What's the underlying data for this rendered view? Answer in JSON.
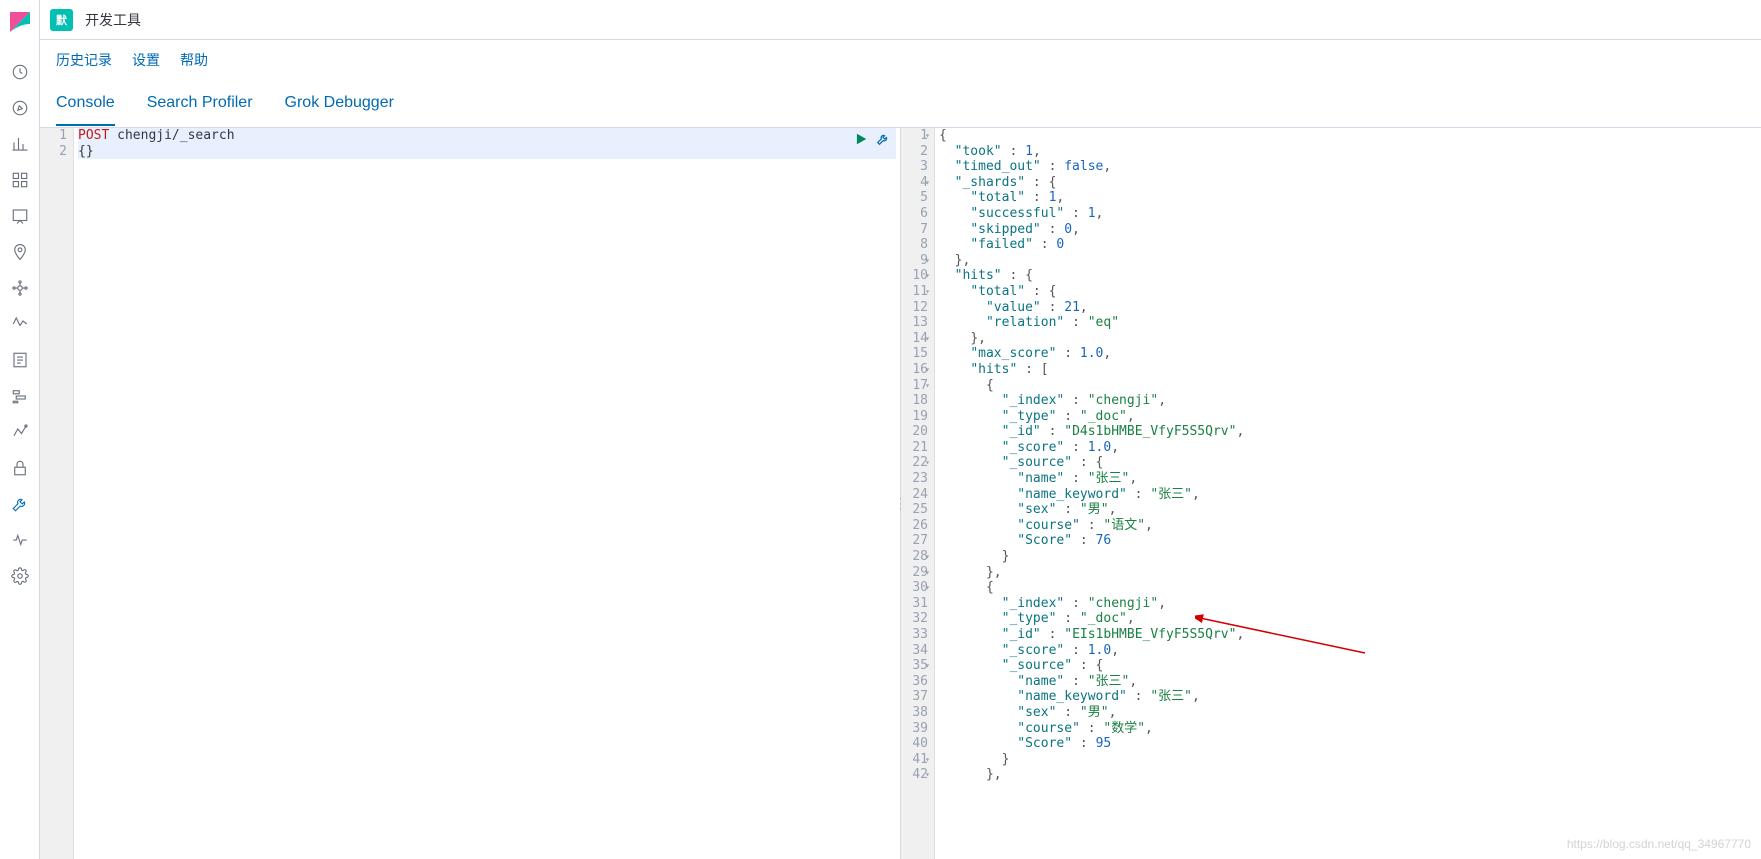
{
  "topbar": {
    "badge": "默",
    "title": "开发工具"
  },
  "subbar": {
    "history": "历史记录",
    "settings": "设置",
    "help": "帮助"
  },
  "tabs": {
    "console": "Console",
    "profiler": "Search Profiler",
    "grok": "Grok Debugger"
  },
  "request": {
    "lines": [
      {
        "num": "1",
        "method": "POST",
        "path": "chengji/_search"
      },
      {
        "num": "2",
        "body": "{}"
      }
    ]
  },
  "response": {
    "lines": [
      {
        "n": "1",
        "fold": true,
        "raw": [
          {
            "p": "{"
          }
        ]
      },
      {
        "n": "2",
        "raw": [
          {
            "t": "ind",
            "v": "  "
          },
          {
            "t": "key",
            "v": "\"took\""
          },
          {
            "p": " : "
          },
          {
            "t": "num",
            "v": "1"
          },
          {
            "p": ","
          }
        ]
      },
      {
        "n": "3",
        "raw": [
          {
            "t": "ind",
            "v": "  "
          },
          {
            "t": "key",
            "v": "\"timed_out\""
          },
          {
            "p": " : "
          },
          {
            "t": "bool",
            "v": "false"
          },
          {
            "p": ","
          }
        ]
      },
      {
        "n": "4",
        "fold": true,
        "raw": [
          {
            "t": "ind",
            "v": "  "
          },
          {
            "t": "key",
            "v": "\"_shards\""
          },
          {
            "p": " : {"
          }
        ]
      },
      {
        "n": "5",
        "raw": [
          {
            "t": "ind",
            "v": "    "
          },
          {
            "t": "key",
            "v": "\"total\""
          },
          {
            "p": " : "
          },
          {
            "t": "num",
            "v": "1"
          },
          {
            "p": ","
          }
        ]
      },
      {
        "n": "6",
        "raw": [
          {
            "t": "ind",
            "v": "    "
          },
          {
            "t": "key",
            "v": "\"successful\""
          },
          {
            "p": " : "
          },
          {
            "t": "num",
            "v": "1"
          },
          {
            "p": ","
          }
        ]
      },
      {
        "n": "7",
        "raw": [
          {
            "t": "ind",
            "v": "    "
          },
          {
            "t": "key",
            "v": "\"skipped\""
          },
          {
            "p": " : "
          },
          {
            "t": "num",
            "v": "0"
          },
          {
            "p": ","
          }
        ]
      },
      {
        "n": "8",
        "raw": [
          {
            "t": "ind",
            "v": "    "
          },
          {
            "t": "key",
            "v": "\"failed\""
          },
          {
            "p": " : "
          },
          {
            "t": "num",
            "v": "0"
          }
        ]
      },
      {
        "n": "9",
        "fold": true,
        "raw": [
          {
            "t": "ind",
            "v": "  "
          },
          {
            "p": "},"
          }
        ]
      },
      {
        "n": "10",
        "fold": true,
        "raw": [
          {
            "t": "ind",
            "v": "  "
          },
          {
            "t": "key",
            "v": "\"hits\""
          },
          {
            "p": " : {"
          }
        ]
      },
      {
        "n": "11",
        "fold": true,
        "raw": [
          {
            "t": "ind",
            "v": "    "
          },
          {
            "t": "key",
            "v": "\"total\""
          },
          {
            "p": " : {"
          }
        ]
      },
      {
        "n": "12",
        "raw": [
          {
            "t": "ind",
            "v": "      "
          },
          {
            "t": "key",
            "v": "\"value\""
          },
          {
            "p": " : "
          },
          {
            "t": "num",
            "v": "21"
          },
          {
            "p": ","
          }
        ]
      },
      {
        "n": "13",
        "raw": [
          {
            "t": "ind",
            "v": "      "
          },
          {
            "t": "key",
            "v": "\"relation\""
          },
          {
            "p": " : "
          },
          {
            "t": "str",
            "v": "\"eq\""
          }
        ]
      },
      {
        "n": "14",
        "fold": true,
        "raw": [
          {
            "t": "ind",
            "v": "    "
          },
          {
            "p": "},"
          }
        ]
      },
      {
        "n": "15",
        "raw": [
          {
            "t": "ind",
            "v": "    "
          },
          {
            "t": "key",
            "v": "\"max_score\""
          },
          {
            "p": " : "
          },
          {
            "t": "num",
            "v": "1.0"
          },
          {
            "p": ","
          }
        ]
      },
      {
        "n": "16",
        "fold": true,
        "raw": [
          {
            "t": "ind",
            "v": "    "
          },
          {
            "t": "key",
            "v": "\"hits\""
          },
          {
            "p": " : ["
          }
        ]
      },
      {
        "n": "17",
        "fold": true,
        "raw": [
          {
            "t": "ind",
            "v": "      "
          },
          {
            "p": "{"
          }
        ]
      },
      {
        "n": "18",
        "raw": [
          {
            "t": "ind",
            "v": "        "
          },
          {
            "t": "key",
            "v": "\"_index\""
          },
          {
            "p": " : "
          },
          {
            "t": "str",
            "v": "\"chengji\""
          },
          {
            "p": ","
          }
        ]
      },
      {
        "n": "19",
        "raw": [
          {
            "t": "ind",
            "v": "        "
          },
          {
            "t": "key",
            "v": "\"_type\""
          },
          {
            "p": " : "
          },
          {
            "t": "str",
            "v": "\"_doc\""
          },
          {
            "p": ","
          }
        ]
      },
      {
        "n": "20",
        "raw": [
          {
            "t": "ind",
            "v": "        "
          },
          {
            "t": "key",
            "v": "\"_id\""
          },
          {
            "p": " : "
          },
          {
            "t": "str",
            "v": "\"D4s1bHMBE_VfyF5S5Qrv\""
          },
          {
            "p": ","
          }
        ]
      },
      {
        "n": "21",
        "raw": [
          {
            "t": "ind",
            "v": "        "
          },
          {
            "t": "key",
            "v": "\"_score\""
          },
          {
            "p": " : "
          },
          {
            "t": "num",
            "v": "1.0"
          },
          {
            "p": ","
          }
        ]
      },
      {
        "n": "22",
        "fold": true,
        "raw": [
          {
            "t": "ind",
            "v": "        "
          },
          {
            "t": "key",
            "v": "\"_source\""
          },
          {
            "p": " : {"
          }
        ]
      },
      {
        "n": "23",
        "raw": [
          {
            "t": "ind",
            "v": "          "
          },
          {
            "t": "key",
            "v": "\"name\""
          },
          {
            "p": " : "
          },
          {
            "t": "str",
            "v": "\"张三\""
          },
          {
            "p": ","
          }
        ]
      },
      {
        "n": "24",
        "raw": [
          {
            "t": "ind",
            "v": "          "
          },
          {
            "t": "key",
            "v": "\"name_keyword\""
          },
          {
            "p": " : "
          },
          {
            "t": "str",
            "v": "\"张三\""
          },
          {
            "p": ","
          }
        ]
      },
      {
        "n": "25",
        "raw": [
          {
            "t": "ind",
            "v": "          "
          },
          {
            "t": "key",
            "v": "\"sex\""
          },
          {
            "p": " : "
          },
          {
            "t": "str",
            "v": "\"男\""
          },
          {
            "p": ","
          }
        ]
      },
      {
        "n": "26",
        "raw": [
          {
            "t": "ind",
            "v": "          "
          },
          {
            "t": "key",
            "v": "\"course\""
          },
          {
            "p": " : "
          },
          {
            "t": "str",
            "v": "\"语文\""
          },
          {
            "p": ","
          }
        ]
      },
      {
        "n": "27",
        "raw": [
          {
            "t": "ind",
            "v": "          "
          },
          {
            "t": "key",
            "v": "\"Score\""
          },
          {
            "p": " : "
          },
          {
            "t": "num",
            "v": "76"
          }
        ]
      },
      {
        "n": "28",
        "fold": true,
        "raw": [
          {
            "t": "ind",
            "v": "        "
          },
          {
            "p": "}"
          }
        ]
      },
      {
        "n": "29",
        "fold": true,
        "raw": [
          {
            "t": "ind",
            "v": "      "
          },
          {
            "p": "},"
          }
        ]
      },
      {
        "n": "30",
        "fold": true,
        "raw": [
          {
            "t": "ind",
            "v": "      "
          },
          {
            "p": "{"
          }
        ]
      },
      {
        "n": "31",
        "raw": [
          {
            "t": "ind",
            "v": "        "
          },
          {
            "t": "key",
            "v": "\"_index\""
          },
          {
            "p": " : "
          },
          {
            "t": "str",
            "v": "\"chengji\""
          },
          {
            "p": ","
          }
        ]
      },
      {
        "n": "32",
        "raw": [
          {
            "t": "ind",
            "v": "        "
          },
          {
            "t": "key",
            "v": "\"_type\""
          },
          {
            "p": " : "
          },
          {
            "t": "str",
            "v": "\"_doc\""
          },
          {
            "p": ","
          }
        ]
      },
      {
        "n": "33",
        "raw": [
          {
            "t": "ind",
            "v": "        "
          },
          {
            "t": "key",
            "v": "\"_id\""
          },
          {
            "p": " : "
          },
          {
            "t": "str",
            "v": "\"EIs1bHMBE_VfyF5S5Qrv\""
          },
          {
            "p": ","
          }
        ]
      },
      {
        "n": "34",
        "raw": [
          {
            "t": "ind",
            "v": "        "
          },
          {
            "t": "key",
            "v": "\"_score\""
          },
          {
            "p": " : "
          },
          {
            "t": "num",
            "v": "1.0"
          },
          {
            "p": ","
          }
        ]
      },
      {
        "n": "35",
        "fold": true,
        "raw": [
          {
            "t": "ind",
            "v": "        "
          },
          {
            "t": "key",
            "v": "\"_source\""
          },
          {
            "p": " : {"
          }
        ]
      },
      {
        "n": "36",
        "raw": [
          {
            "t": "ind",
            "v": "          "
          },
          {
            "t": "key",
            "v": "\"name\""
          },
          {
            "p": " : "
          },
          {
            "t": "str",
            "v": "\"张三\""
          },
          {
            "p": ","
          }
        ]
      },
      {
        "n": "37",
        "raw": [
          {
            "t": "ind",
            "v": "          "
          },
          {
            "t": "key",
            "v": "\"name_keyword\""
          },
          {
            "p": " : "
          },
          {
            "t": "str",
            "v": "\"张三\""
          },
          {
            "p": ","
          }
        ]
      },
      {
        "n": "38",
        "raw": [
          {
            "t": "ind",
            "v": "          "
          },
          {
            "t": "key",
            "v": "\"sex\""
          },
          {
            "p": " : "
          },
          {
            "t": "str",
            "v": "\"男\""
          },
          {
            "p": ","
          }
        ]
      },
      {
        "n": "39",
        "raw": [
          {
            "t": "ind",
            "v": "          "
          },
          {
            "t": "key",
            "v": "\"course\""
          },
          {
            "p": " : "
          },
          {
            "t": "str",
            "v": "\"数学\""
          },
          {
            "p": ","
          }
        ]
      },
      {
        "n": "40",
        "raw": [
          {
            "t": "ind",
            "v": "          "
          },
          {
            "t": "key",
            "v": "\"Score\""
          },
          {
            "p": " : "
          },
          {
            "t": "num",
            "v": "95"
          }
        ]
      },
      {
        "n": "41",
        "fold": true,
        "raw": [
          {
            "t": "ind",
            "v": "        "
          },
          {
            "p": "}"
          }
        ]
      },
      {
        "n": "42",
        "fold": true,
        "raw": [
          {
            "t": "ind",
            "v": "      "
          },
          {
            "p": "},"
          }
        ]
      }
    ]
  },
  "watermark": "https://blog.csdn.net/qq_34967770"
}
